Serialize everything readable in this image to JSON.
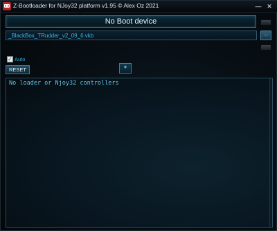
{
  "window": {
    "title": "Z-Bootloader for NJoy32 platform v1.95 © Alex Oz 2021",
    "minimize_glyph": "—",
    "close_glyph": "✕",
    "icon": "app-icon"
  },
  "status": {
    "text": "No Boot device"
  },
  "file": {
    "path": "_BlackBox_TRudder_v2_09_6.vkb",
    "browse_label": "..."
  },
  "options": {
    "auto_label": "Auto",
    "auto_checked": true,
    "check_glyph": "✓"
  },
  "buttons": {
    "reset_label": "RESET",
    "asterisk_label": "*"
  },
  "console": {
    "text": "No loader or Njoy32 controllers"
  },
  "colors": {
    "accent": "#3eb6e6",
    "background": "#05090c"
  }
}
